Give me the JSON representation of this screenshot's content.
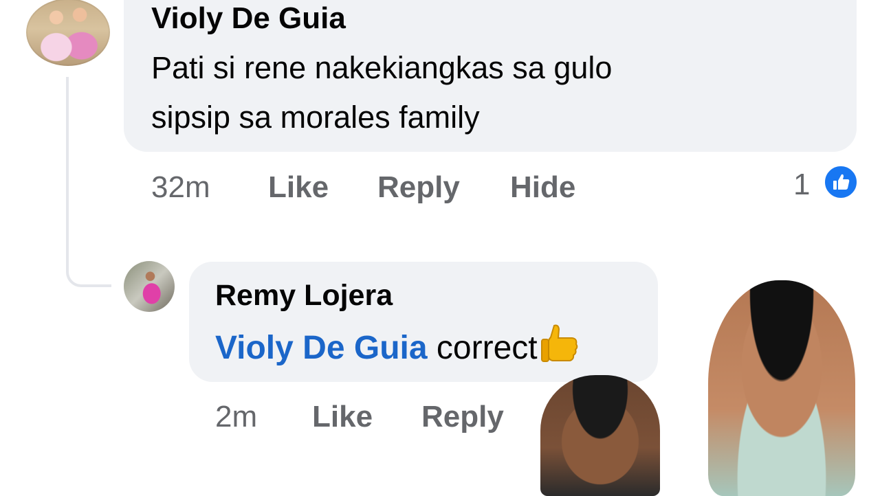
{
  "comment": {
    "author": "Violy De Guia",
    "text_lines": [
      "Pati si rene nakekiangkas sa gulo",
      "sipsip sa morales family"
    ],
    "time": "32m",
    "actions": [
      "Like",
      "Reply",
      "Hide"
    ],
    "reaction_count": "1",
    "reaction_icon": "like-icon"
  },
  "reply": {
    "author": "Remy Lojera",
    "mention": "Violy De Guia",
    "text": "correct",
    "emoji": "thumbs-up-icon",
    "time": "2m",
    "actions": [
      "Like",
      "Reply"
    ]
  },
  "colors": {
    "bubble": "#f0f2f5",
    "mention": "#1b66c9",
    "muted": "#65676b",
    "like_badge": "#1877f2"
  }
}
